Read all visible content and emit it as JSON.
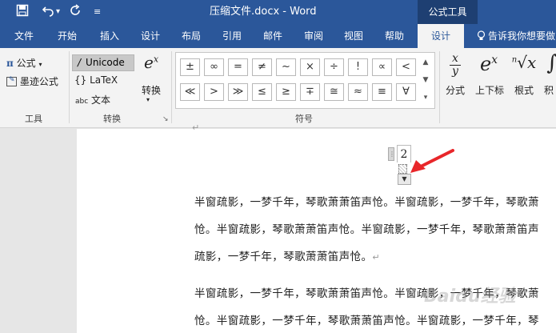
{
  "titlebar": {
    "save_icon": "save-icon",
    "undo_icon": "undo-icon",
    "redo_icon": "redo-icon",
    "customize_icon": "customize-qat-icon",
    "title": "压缩文件.docx  -  Word",
    "context_tools": "公式工具"
  },
  "tabs": [
    {
      "label": "文件"
    },
    {
      "label": "开始"
    },
    {
      "label": "插入"
    },
    {
      "label": "设计"
    },
    {
      "label": "布局"
    },
    {
      "label": "引用"
    },
    {
      "label": "邮件"
    },
    {
      "label": "审阅"
    },
    {
      "label": "视图"
    },
    {
      "label": "帮助"
    },
    {
      "label": "设计"
    }
  ],
  "tellme": "告诉我你想要做",
  "tools_group": {
    "equation": "公式",
    "ink_equation": "墨迹公式",
    "label": "工具"
  },
  "convert_group": {
    "unicode": "Unicode",
    "latex": "LaTeX",
    "text": "文本",
    "text_prefix": "abc",
    "convert": "转换",
    "label": "转换"
  },
  "symbols_group": {
    "row1": [
      "±",
      "∞",
      "=",
      "≠",
      "~",
      "×",
      "÷",
      "!",
      "∝",
      "<"
    ],
    "row2": [
      "≪",
      ">",
      "≫",
      "≤",
      "≥",
      "∓",
      "≅",
      "≈",
      "≡",
      "∀"
    ],
    "label": "符号"
  },
  "structures": {
    "fraction": "分式",
    "script": "上下标",
    "radical": "根式",
    "integral": "积"
  },
  "document": {
    "equation_number": "2",
    "lines": [
      "半窗疏影，一梦千年，琴歌萧萧笛声怆。半窗疏影，一梦千年，琴歌萧",
      "怆。半窗疏影，琴歌萧萧笛声怆。半窗疏影，一梦千年，琴歌萧萧笛声",
      "疏影，一梦千年，琴歌萧萧笛声怆。",
      "半窗疏影，一梦千年，琴歌萧萧笛声怆。半窗疏影，一梦千年，琴歌萧",
      "怆。半窗疏影，一梦千年，琴歌萧萧笛声怆。半窗疏影，一梦千年，琴"
    ],
    "para_mark": "↵"
  },
  "watermark": "Baidu经验"
}
